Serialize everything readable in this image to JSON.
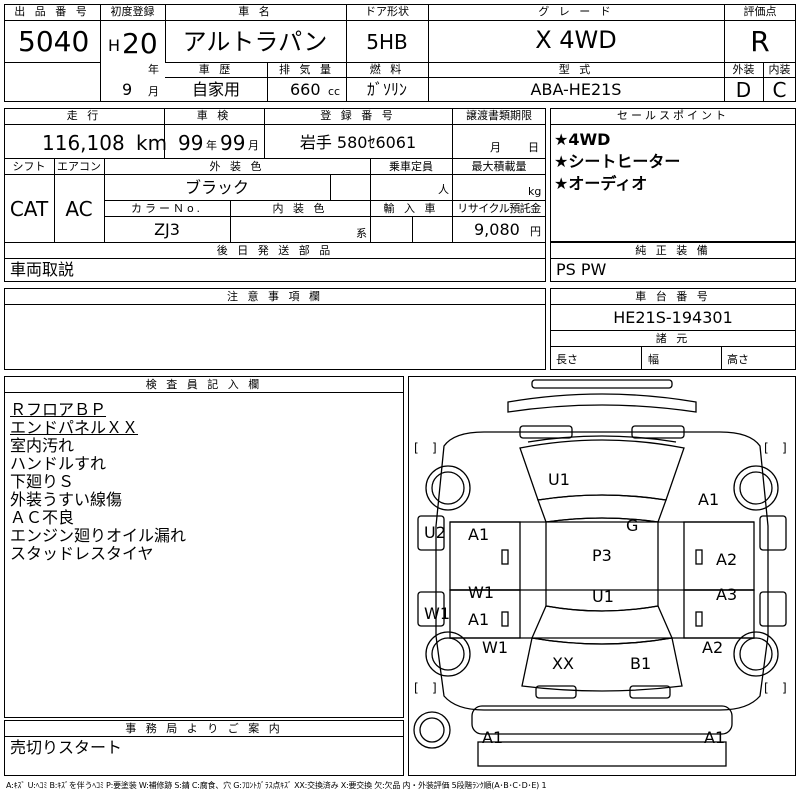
{
  "header": {
    "lot_label": "出 品 番 号",
    "lot_number": "5040",
    "first_reg_label": "初度登録",
    "era": "H",
    "reg_year": "20",
    "year_unit": "年",
    "reg_month": "9",
    "month_unit": "月",
    "car_name_label": "車 名",
    "car_name": "アルトラパン",
    "door_label": "ドア形状",
    "door": "5HB",
    "grade_label": "グ レ ー ド",
    "grade": "X 4WD",
    "score_label": "評価点",
    "score": "R",
    "history_label": "車 歴",
    "history": "自家用",
    "displacement_label": "排 気 量",
    "displacement": "660",
    "cc": "cc",
    "fuel_label": "燃 料",
    "fuel": "ｶﾞｿﾘﾝ",
    "model_label": "型 式",
    "model": "ABA-HE21S",
    "exterior_label": "外装",
    "exterior": "D",
    "interior_label": "内装",
    "interior": "C"
  },
  "details": {
    "mileage_label": "走 行",
    "mileage": "116,108",
    "km": "km",
    "inspection_label": "車 検",
    "insp_year": "99",
    "insp_year_unit": "年",
    "insp_month": "99",
    "insp_month_unit": "月",
    "plate_label": "登 録 番 号",
    "plate": "岩手 580ｾ6061",
    "transfer_label": "譲渡書類期限",
    "transfer_month": "月",
    "transfer_day": "日",
    "shift_label": "シフト",
    "shift": "CAT",
    "ac_label": "エアコン",
    "ac": "AC",
    "ext_color_label": "外 装 色",
    "ext_color": "ブラック",
    "capacity_label": "乗車定員",
    "capacity_unit": "人",
    "max_load_label": "最大積載量",
    "max_load_unit": "kg",
    "color_no_label": "カラーＮo.",
    "color_no": "ZJ3",
    "int_color_label": "内 装 色",
    "int_color_unit": "系",
    "import_label": "輸 入 車",
    "recycle_label": "リサイクル預託金",
    "recycle": "9,080",
    "recycle_unit": "円",
    "later_parts_label": "後 日 発 送 部 品",
    "later_parts": "車両取説"
  },
  "sales": {
    "label": "セールスポイント",
    "points": [
      "★4WD",
      "★シートヒーター",
      "★オーディオ"
    ]
  },
  "equipment": {
    "label": "純 正 装 備",
    "value": "PS PW"
  },
  "notes": {
    "label": "注 意 事 項 欄"
  },
  "chassis": {
    "label": "車 台 番 号",
    "value": "HE21S-194301"
  },
  "dims": {
    "label": "諸 元",
    "length": "長さ",
    "width": "幅",
    "height": "高さ"
  },
  "inspector": {
    "label": "検 査 員 記 入 欄",
    "lines": [
      "ＲフロアＢＰ",
      "エンドパネルＸＸ",
      "室内汚れ",
      "ハンドルすれ",
      "下廻りＳ",
      "外装うすい線傷",
      "ＡＣ不良",
      "エンジン廻りオイル漏れ",
      "スタッドレスタイヤ"
    ]
  },
  "office": {
    "label": "事 務 局 よ り ご 案 内",
    "message": "売切りスタート"
  },
  "diagram": {
    "marks": [
      {
        "id": "hood",
        "text": "U1"
      },
      {
        "id": "front-right-fender",
        "text": "A1"
      },
      {
        "id": "windshield",
        "text": "G"
      },
      {
        "id": "left-side",
        "text": "U2"
      },
      {
        "id": "left-front-door",
        "text": "A1"
      },
      {
        "id": "roof",
        "text": "P3"
      },
      {
        "id": "right-front-door",
        "text": "A2"
      },
      {
        "id": "left-rear-door-w",
        "text": "W1"
      },
      {
        "id": "left-rear-door-a",
        "text": "A1"
      },
      {
        "id": "trunk-area",
        "text": "U1"
      },
      {
        "id": "right-rear-door",
        "text": "A3"
      },
      {
        "id": "left-pillar",
        "text": "W1"
      },
      {
        "id": "left-rear-fender",
        "text": "W1"
      },
      {
        "id": "right-rear-fender",
        "text": "A2"
      },
      {
        "id": "rear-panel",
        "text": "XX"
      },
      {
        "id": "rear-floor",
        "text": "B1"
      },
      {
        "id": "rear-bumper-left",
        "text": "A1"
      },
      {
        "id": "rear-bumper-right",
        "text": "A1"
      }
    ]
  },
  "legend": "A:ｷｽﾞ U:ﾍｺﾐ B:ｷｽﾞを伴うﾍｺﾐ P:要塗装 W:補修跡 S:錆 C:腐食、穴 G:ﾌﾛﾝﾄｶﾞﾗｽ点ｷｽﾞ XX:交換済み X:要交換 欠:欠品 内・外装評価 5段階ﾗﾝｸ順(A･B･C･D･E) 1"
}
